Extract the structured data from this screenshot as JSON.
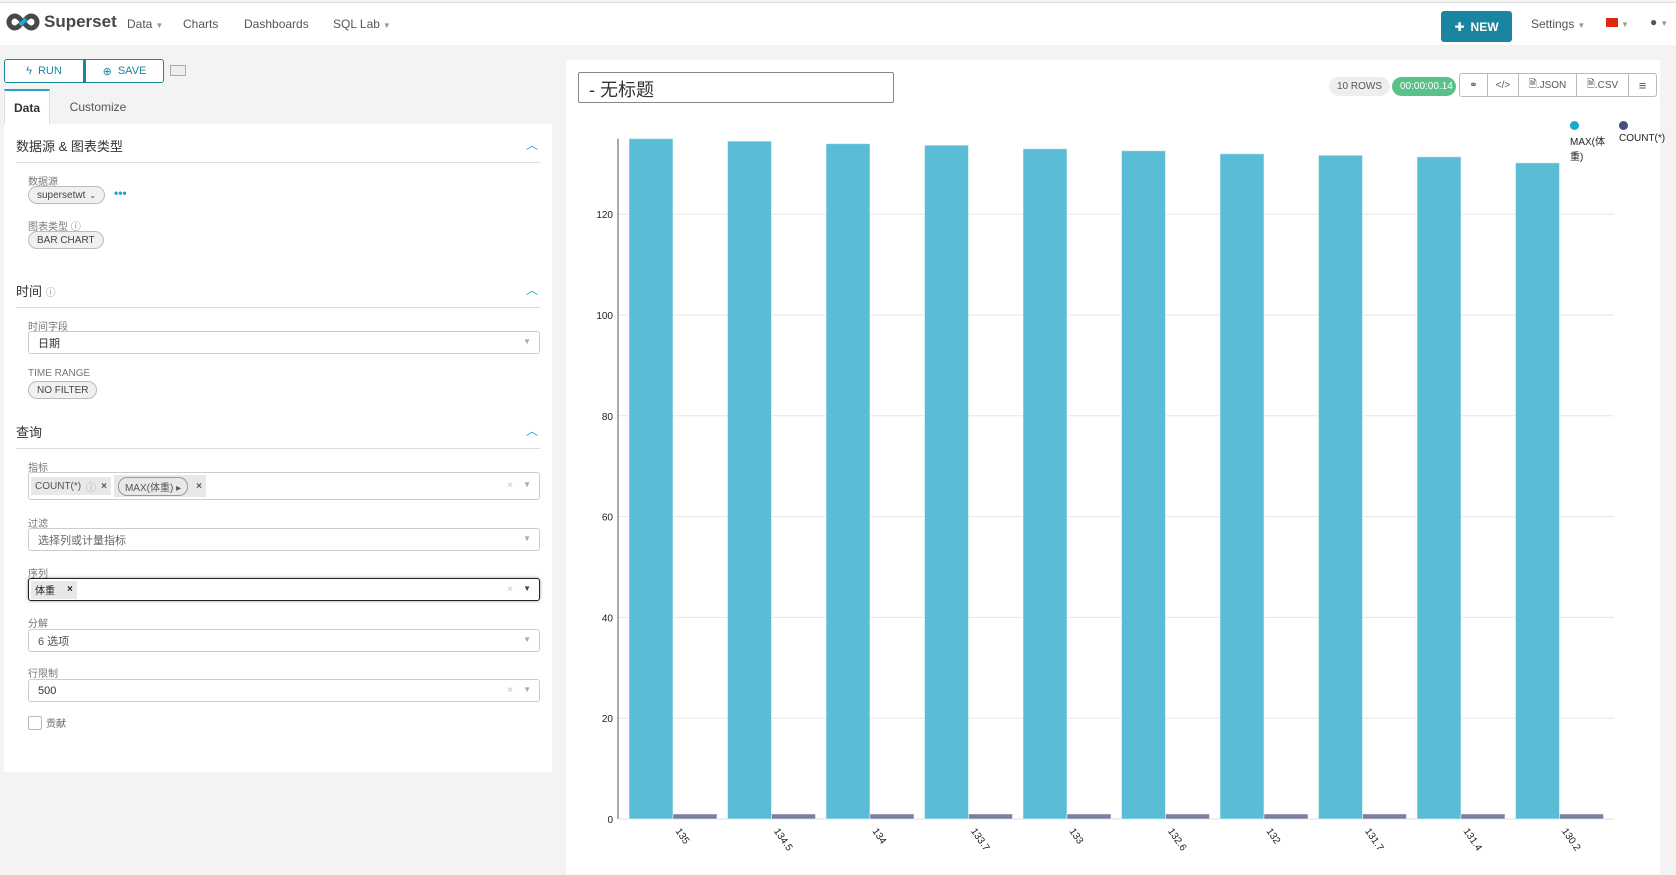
{
  "nav": {
    "brand": "Superset",
    "items": [
      {
        "label": "Data",
        "dropdown": true
      },
      {
        "label": "Charts",
        "dropdown": false
      },
      {
        "label": "Dashboards",
        "dropdown": false
      },
      {
        "label": "SQL Lab",
        "dropdown": true
      }
    ],
    "new_label": "NEW",
    "settings_label": "Settings",
    "accent": "#1a85a0"
  },
  "toolbar": {
    "run_label": "RUN",
    "save_label": "SAVE"
  },
  "tabs": [
    {
      "label": "Data",
      "active": true
    },
    {
      "label": "Customize",
      "active": false
    }
  ],
  "sections": {
    "datasource": {
      "title": "数据源 & 图表类型",
      "datasource_label": "数据源",
      "datasource_value": "supersetwt",
      "viz_label": "图表类型",
      "viz_value": "BAR CHART"
    },
    "time": {
      "title": "时间",
      "time_col_label": "时间字段",
      "time_col_value": "日期",
      "time_range_label": "TIME RANGE",
      "time_range_value": "NO FILTER"
    },
    "query": {
      "title": "查询",
      "metrics_label": "指标",
      "metrics": [
        "COUNT(*)",
        "MAX(体重)"
      ],
      "filter_label": "过滤",
      "filter_placeholder": "选择列或计量指标",
      "series_label": "序列",
      "series": [
        "体重"
      ],
      "breakdown_label": "分解",
      "breakdown_value": "6 选项",
      "row_limit_label": "行限制",
      "row_limit_value": "500",
      "contribution_label": "贡献",
      "contribution_checked": false
    }
  },
  "chart_panel": {
    "title": "- 无标题",
    "rows_badge": "10 ROWS",
    "timer": "00:00:00.14",
    "json_label": ".JSON",
    "csv_label": ".CSV"
  },
  "chart_data": {
    "type": "bar",
    "categories": [
      "135",
      "134.5",
      "134",
      "133.7",
      "133",
      "132.6",
      "132",
      "131.7",
      "131.4",
      "130.2"
    ],
    "series": [
      {
        "name": "MAX(体重)",
        "color": "#5bbdd5",
        "values": [
          135,
          134.5,
          134,
          133.7,
          133,
          132.6,
          132,
          131.7,
          131.4,
          130.2
        ]
      },
      {
        "name": "COUNT(*)",
        "color": "#7a7fa0",
        "values": [
          1,
          1,
          1,
          1,
          1,
          1,
          1,
          1,
          1,
          1
        ]
      }
    ],
    "yticks": [
      0,
      20,
      40,
      60,
      80,
      100,
      120
    ],
    "ylim": [
      0,
      135
    ],
    "legend": "top-right",
    "grid": true
  }
}
